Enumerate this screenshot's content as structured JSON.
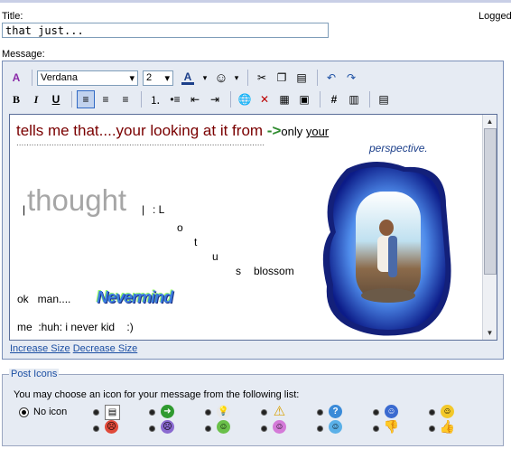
{
  "header": {
    "title_label": "Title:",
    "logged_label": "Logged",
    "message_label": "Message:"
  },
  "title_value": "that just...",
  "toolbar": {
    "font": "Verdana",
    "size": "2",
    "bold": "B",
    "italic": "I",
    "underline": "U",
    "color_glyph": "A",
    "hash": "#"
  },
  "message": {
    "line1_main": "tells me that....your looking at it from ",
    "line1_arrow": "->",
    "line1_only": "only ",
    "line1_your": "your",
    "dotted_line": "...................................................................................................",
    "perspective": "perspective",
    "perspective_dot": ".",
    "bar_left": "|",
    "thought": "thought",
    "bar_right": "|",
    "lotus": [
      ": L",
      "o",
      "t",
      "u",
      "s"
    ],
    "blossom": "blossom",
    "ok_man": "ok   man....",
    "nevermind": "Nevermind",
    "never_kid": "me  :huh: i never kid    :)"
  },
  "size_links": {
    "increase": "Increase Size",
    "decrease": "Decrease Size"
  },
  "post_icons": {
    "legend": "Post Icons",
    "instruction": "You may choose an icon for your message from the following list:",
    "no_icon": "No icon"
  },
  "colors": {
    "accent": "#1c4fa3",
    "dark_red": "#7a0000",
    "frame_bg": "#e6ebf3"
  }
}
